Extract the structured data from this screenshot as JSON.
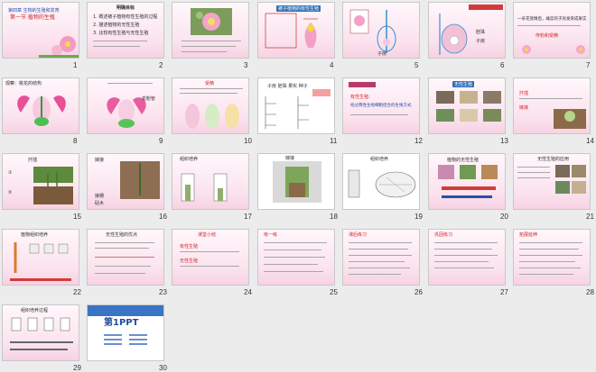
{
  "slides": [
    {
      "n": "1",
      "texts": [
        "第一节  植物的生殖",
        "第四章  生物的生殖和发育"
      ]
    },
    {
      "n": "2",
      "texts": [
        "明确目标",
        "1. 概述被子植物有性生殖的过程",
        "2. 描述植物的无性生殖",
        "3. 比较有性生殖与无性生殖"
      ]
    },
    {
      "n": "3",
      "texts": [
        "桃花的结构",
        "雌蕊 雄蕊"
      ]
    },
    {
      "n": "4",
      "texts": [
        "被子植物的有性生殖"
      ]
    },
    {
      "n": "5",
      "texts": [
        "子房"
      ]
    },
    {
      "n": "6",
      "texts": [
        "胚珠",
        "子房"
      ]
    },
    {
      "n": "7",
      "texts": [
        "一朵花受精后，雌蕊的子房发育成果实",
        "传粉和受精"
      ]
    },
    {
      "n": "8",
      "texts": [
        "观察：桃花的结构"
      ]
    },
    {
      "n": "9",
      "texts": [
        "花粉管"
      ]
    },
    {
      "n": "10",
      "texts": [
        "受精"
      ]
    },
    {
      "n": "11",
      "texts": [
        "子房 胚珠 果实 种子"
      ]
    },
    {
      "n": "12",
      "texts": [
        "有性生殖：",
        "经过两性生殖细胞结合的生殖方式"
      ]
    },
    {
      "n": "13",
      "texts": [
        "无性生殖"
      ]
    },
    {
      "n": "14",
      "texts": [
        "扦插",
        "嫁接"
      ]
    },
    {
      "n": "15",
      "texts": [
        "扦插",
        "①",
        "②"
      ]
    },
    {
      "n": "16",
      "texts": [
        "嫁接",
        "接穗",
        "砧木"
      ]
    },
    {
      "n": "17",
      "texts": [
        "组织培养"
      ]
    },
    {
      "n": "18",
      "texts": [
        "嫁接"
      ]
    },
    {
      "n": "19",
      "texts": [
        "组织培养"
      ]
    },
    {
      "n": "20",
      "texts": [
        "植物的无性生殖"
      ]
    },
    {
      "n": "21",
      "texts": [
        "无性生殖的应用"
      ]
    },
    {
      "n": "22",
      "texts": [
        "植物组织培养"
      ]
    },
    {
      "n": "23",
      "texts": [
        "无性生殖的优点"
      ]
    },
    {
      "n": "24",
      "texts": [
        "课堂小结",
        "有性生殖",
        "无性生殖"
      ]
    },
    {
      "n": "25",
      "texts": [
        "练一练"
      ]
    },
    {
      "n": "26",
      "texts": [
        "课后练习"
      ]
    },
    {
      "n": "27",
      "texts": [
        "巩固练习"
      ]
    },
    {
      "n": "28",
      "texts": [
        "拓展延伸"
      ]
    },
    {
      "n": "29",
      "texts": [
        "组织培养过程"
      ]
    },
    {
      "n": "30",
      "texts": [
        "第1PPT"
      ]
    }
  ]
}
